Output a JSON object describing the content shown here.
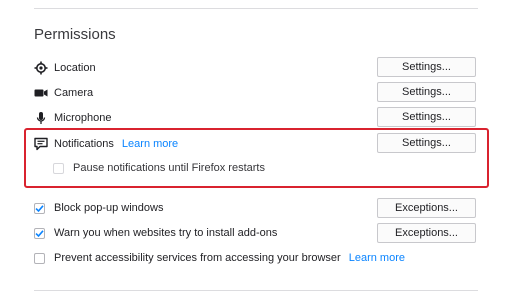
{
  "section": {
    "title": "Permissions"
  },
  "permissions": [
    {
      "label": "Location",
      "icon": "location-icon",
      "button": "Settings..."
    },
    {
      "label": "Camera",
      "icon": "camera-icon",
      "button": "Settings..."
    },
    {
      "label": "Microphone",
      "icon": "microphone-icon",
      "button": "Settings..."
    },
    {
      "label": "Notifications",
      "icon": "notifications-icon",
      "link": "Learn more",
      "button": "Settings..."
    }
  ],
  "pause_notifications": {
    "label": "Pause notifications until Firefox restarts",
    "checked": false
  },
  "options": [
    {
      "label": "Block pop-up windows",
      "checked": true,
      "button": "Exceptions..."
    },
    {
      "label": "Warn you when websites try to install add-ons",
      "checked": true,
      "button": "Exceptions..."
    },
    {
      "label": "Prevent accessibility services from accessing your browser",
      "checked": false,
      "link": "Learn more"
    }
  ],
  "colors": {
    "link": "#0a84ff",
    "highlight": "#d9232f",
    "check": "#0a84ff"
  }
}
